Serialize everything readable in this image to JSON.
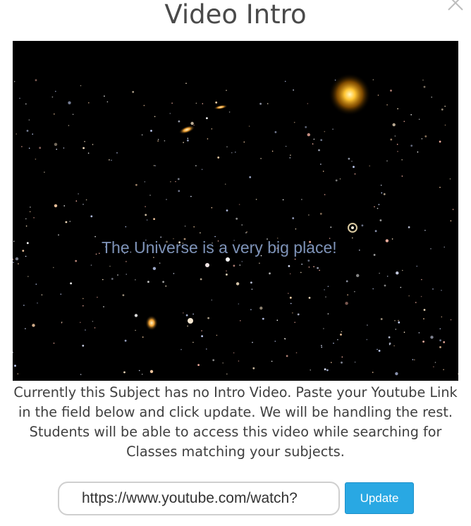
{
  "modal": {
    "title": "Video Intro"
  },
  "video": {
    "caption": "The Universe is a very big place!"
  },
  "description": "Currently this Subject has no Intro Video. Paste your Youtube Link in the field below and click update. We will be handling the rest. Students will be able to access this video while searching for Classes matching your subjects.",
  "url_input": {
    "value": "https://www.youtube.com/watch?"
  },
  "update_button": {
    "label": "Update"
  },
  "icons": {
    "close": "close-icon"
  },
  "colors": {
    "accent": "#29a8e3",
    "title": "#4a4a4a",
    "text": "#3f3f3f",
    "caption": "#7e93b8"
  }
}
